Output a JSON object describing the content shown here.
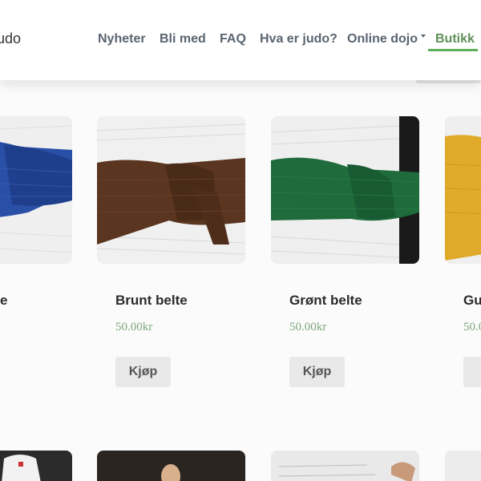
{
  "header": {
    "brand_partial": "udo",
    "nav": [
      {
        "label": "Nyheter"
      },
      {
        "label": "Bli med"
      },
      {
        "label": "FAQ"
      },
      {
        "label": "Hva er judo?"
      },
      {
        "label": "Online dojo"
      },
      {
        "label": "Butikk",
        "active": true
      }
    ]
  },
  "products": [
    {
      "title": "e",
      "price": "",
      "buy_label": "",
      "belt_color": "#2a4fa6"
    },
    {
      "title": "Brunt belte",
      "price": "50.00kr",
      "buy_label": "Kjøp",
      "belt_color": "#5a3520"
    },
    {
      "title": "Grønt belte",
      "price": "50.00kr",
      "buy_label": "Kjøp",
      "belt_color": "#1f6b3c"
    },
    {
      "title": "Gu",
      "price": "50.0",
      "buy_label": "K",
      "belt_color": "#e0a92a"
    }
  ],
  "colors": {
    "accent": "#5fae5a",
    "price": "#7da87a",
    "nav_text": "#5a6470"
  }
}
